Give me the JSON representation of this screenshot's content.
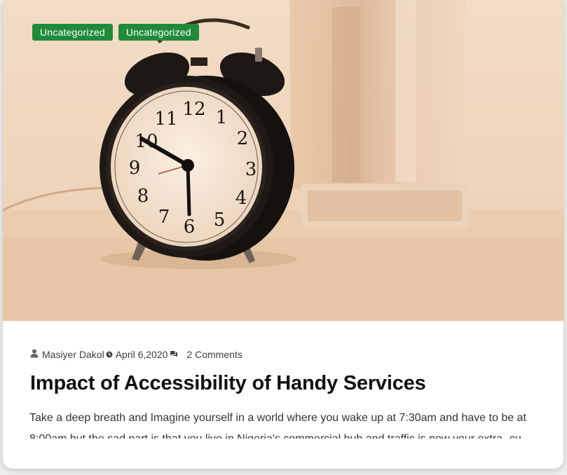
{
  "post": {
    "categories": [
      "Uncategorized",
      "Uncategorized"
    ],
    "meta": {
      "author": "Masiyer Dakol",
      "author_icon": "user-icon",
      "date": "April 6,2020",
      "date_icon": "clock-icon",
      "comments": "2 Comments",
      "comments_icon": "comment-icon"
    },
    "title": "Impact of Accessibility of Handy Services",
    "excerpt": "Take a deep breath and Imagine yourself in a world where you wake up at 7:30am and have to be at 8:00am but the sad part is that you live in Nigeria's commercial hub and traffic is now your extra- cu",
    "clock_numerals": [
      "12",
      "1",
      "2",
      "3",
      "4",
      "5",
      "6",
      "7",
      "8",
      "9",
      "10",
      "11"
    ]
  },
  "colors": {
    "tag_background": "#1f8b3a",
    "title": "#111111",
    "text": "#333333"
  }
}
